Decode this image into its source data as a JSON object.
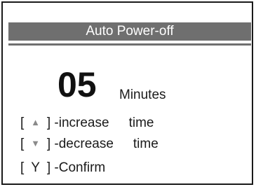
{
  "screen": {
    "title": "Auto Power-off"
  },
  "setting": {
    "value": "05",
    "unit": "Minutes"
  },
  "help": {
    "rows": [
      {
        "open": "[",
        "key_icon": "up-arrow-icon",
        "key_glyph": "▲",
        "close": "]",
        "action": "-increase",
        "object": "time"
      },
      {
        "open": "[",
        "key_icon": "down-arrow-icon",
        "key_glyph": "▼",
        "close": "]",
        "action": "-decrease",
        "object": "time"
      },
      {
        "open": "[",
        "key_label": "Y",
        "close": "]",
        "action": "-Confirm"
      }
    ]
  },
  "colors": {
    "title_bar": "#6f6f6f",
    "title_text": "#ffffff",
    "frame": "#1a1a1a",
    "arrow_key": "#8a8a8a"
  }
}
